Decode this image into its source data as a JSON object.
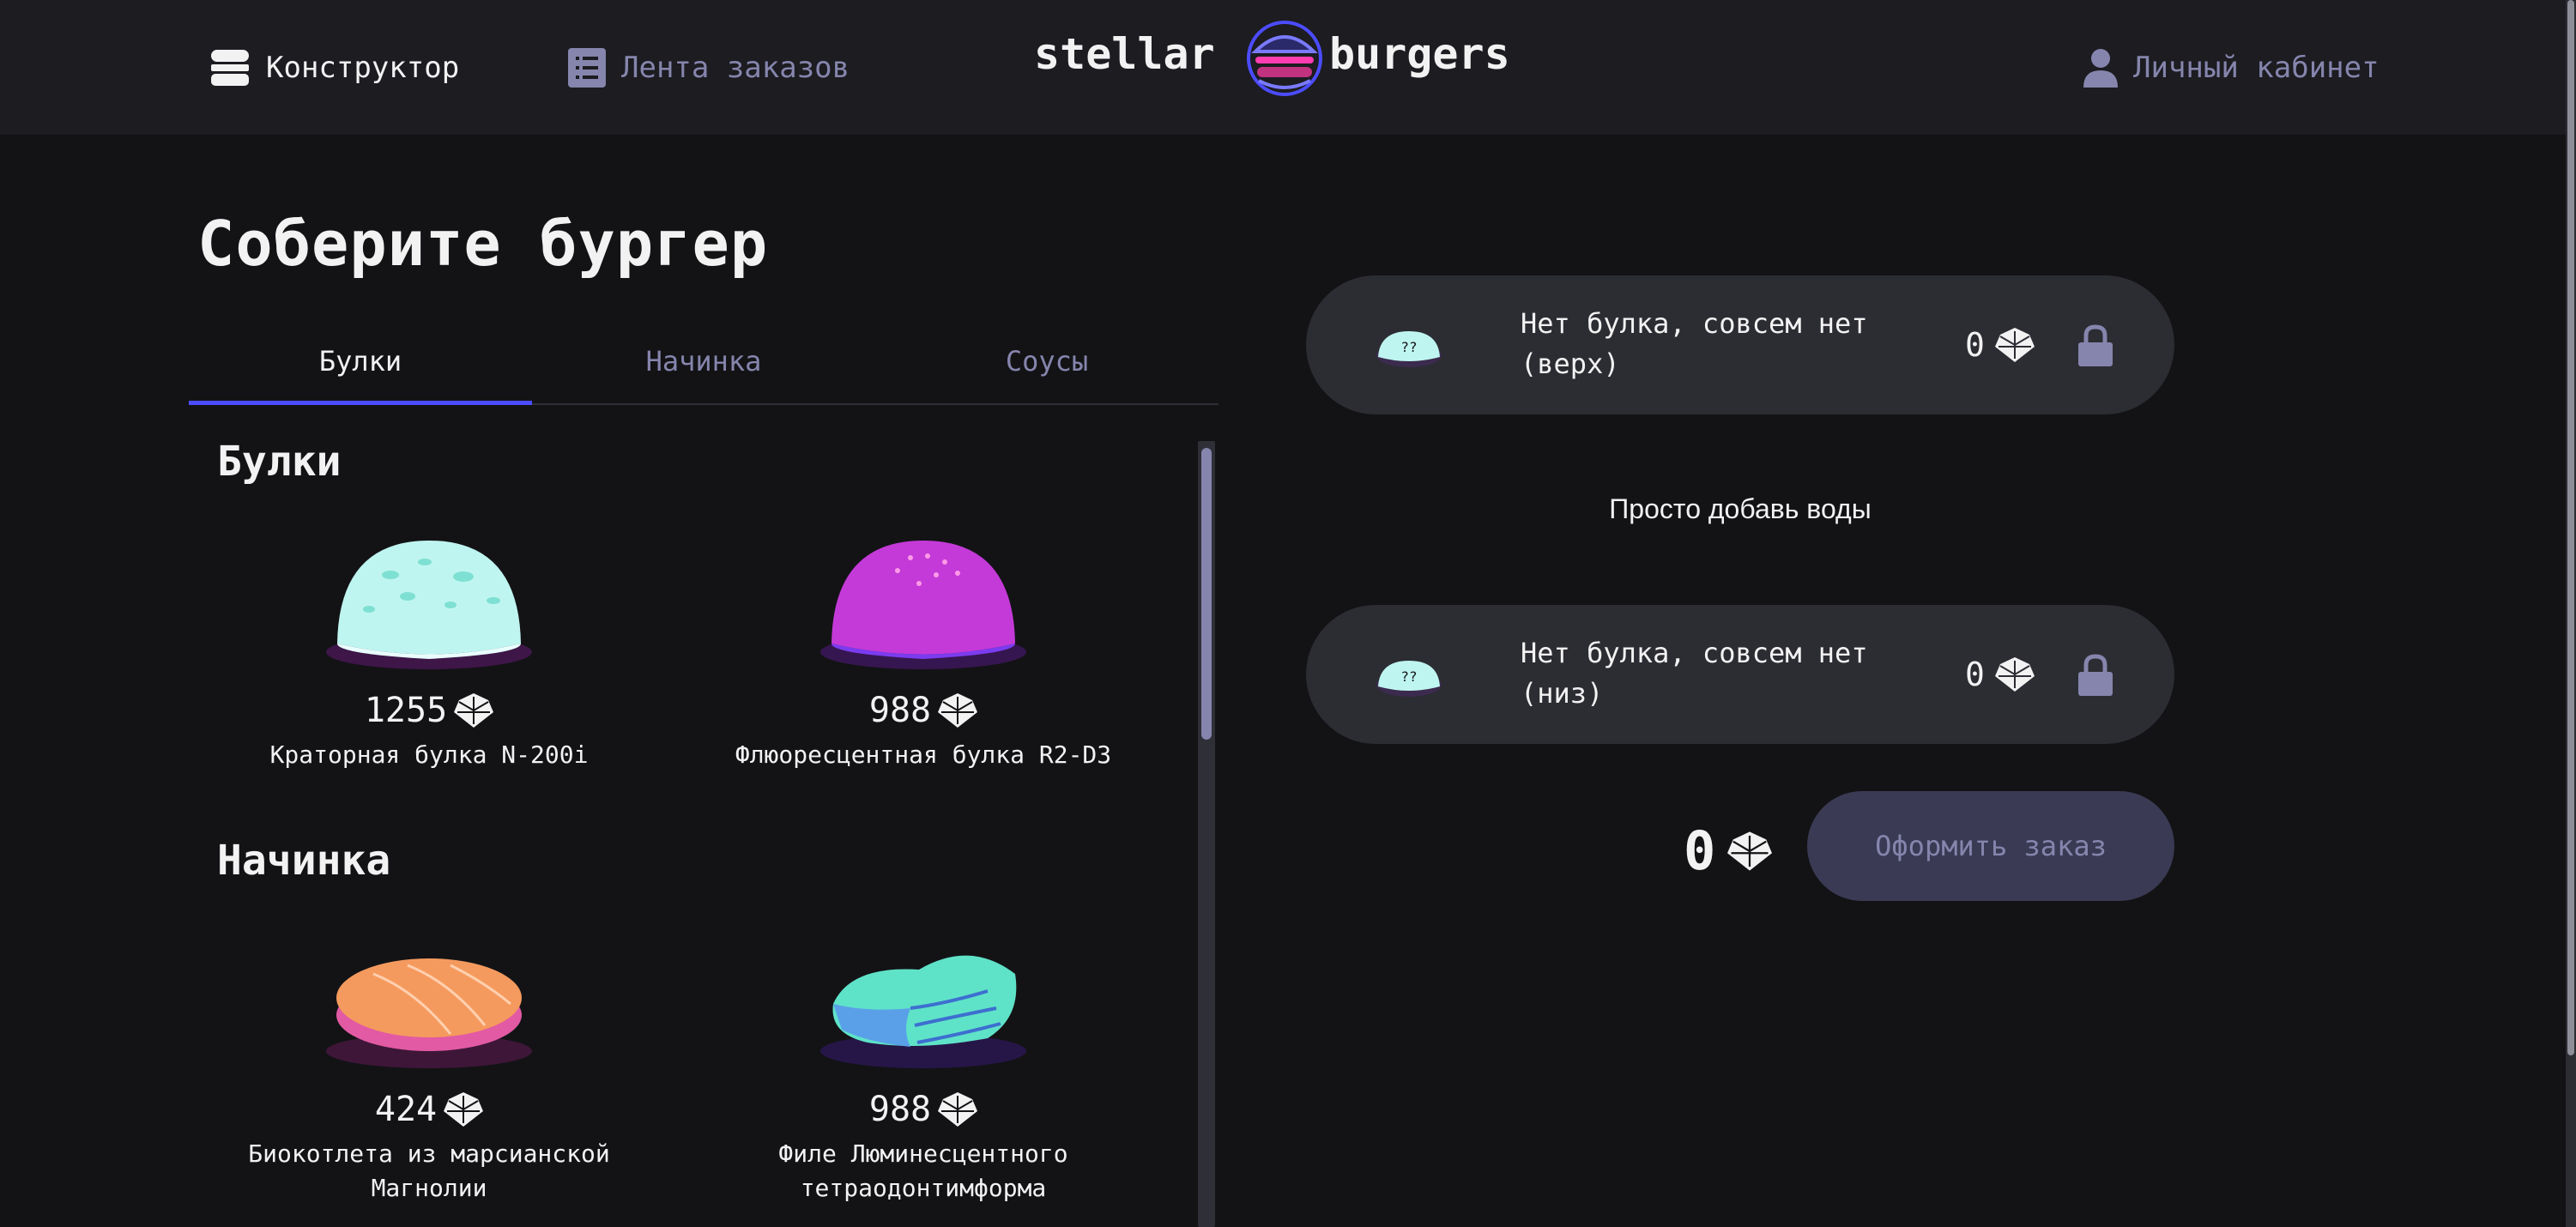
{
  "header": {
    "constructor_label": "Конструктор",
    "feed_label": "Лента заказов",
    "logo_left": "stellar",
    "logo_right": "burgers",
    "profile_label": "Личный кабинет"
  },
  "main": {
    "title": "Соберите бургер",
    "tabs": [
      {
        "label": "Булки",
        "active": true
      },
      {
        "label": "Начинка",
        "active": false
      },
      {
        "label": "Соусы",
        "active": false
      }
    ],
    "sections": [
      {
        "title": "Булки",
        "items": [
          {
            "price": "1255",
            "name": "Краторная булка N-200i",
            "icon": "crater-bun-icon"
          },
          {
            "price": "988",
            "name": "Флюоресцентная булка R2-D3",
            "icon": "fluorescent-bun-icon"
          }
        ]
      },
      {
        "title": "Начинка",
        "items": [
          {
            "price": "424",
            "name_line1": "Биокотлета из марсианской",
            "name_line2": "Магнолии",
            "icon": "bio-patty-icon"
          },
          {
            "price": "988",
            "name_line1": "Филе Люминесцентного",
            "name_line2": "тетраодонтимформа",
            "icon": "fish-fillet-icon"
          }
        ]
      }
    ]
  },
  "constructor": {
    "top_bun": {
      "line1": "Нет булка, совсем нет",
      "line2": "(верх)",
      "price": "0",
      "thumb_text": "??"
    },
    "placeholder": "Просто добавь воды",
    "bottom_bun": {
      "line1": "Нет булка, совсем нет",
      "line2": "(низ)",
      "price": "0",
      "thumb_text": "??"
    },
    "total": "0",
    "order_button": "Оформить заказ"
  },
  "colors": {
    "accent": "#4c4cff",
    "background": "#131316",
    "header": "#1c1c21",
    "inactive_text": "#8585ad",
    "constructor_item": "#2c2c33",
    "order_button_disabled": "#3a3a54"
  }
}
